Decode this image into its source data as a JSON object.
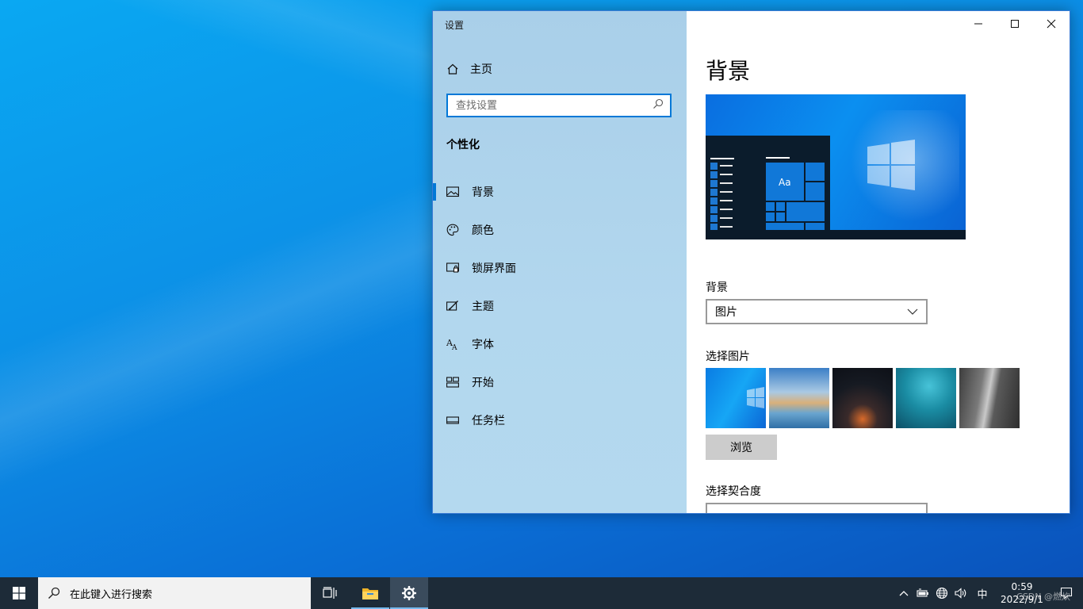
{
  "window": {
    "title": "设置",
    "controls": [
      "minimize",
      "maximize",
      "close"
    ]
  },
  "sidebar": {
    "home_label": "主页",
    "search_placeholder": "查找设置",
    "section_title": "个性化",
    "items": [
      {
        "label": "背景",
        "icon": "picture-icon",
        "active": true
      },
      {
        "label": "颜色",
        "icon": "palette-icon",
        "active": false
      },
      {
        "label": "锁屏界面",
        "icon": "lock-screen-icon",
        "active": false
      },
      {
        "label": "主题",
        "icon": "theme-icon",
        "active": false
      },
      {
        "label": "字体",
        "icon": "font-icon",
        "active": false
      },
      {
        "label": "开始",
        "icon": "start-icon",
        "active": false
      },
      {
        "label": "任务栏",
        "icon": "taskbar-icon",
        "active": false
      }
    ]
  },
  "main": {
    "heading": "背景",
    "preview": {
      "tile_text": "Aa"
    },
    "background_label": "背景",
    "background_value": "图片",
    "choose_picture_label": "选择图片",
    "browse_label": "浏览",
    "fit_label": "选择契合度"
  },
  "taskbar": {
    "search_placeholder": "在此键入进行搜索",
    "ime": "中",
    "time": "0:59",
    "date": "2022/9/1",
    "watermark": "CSDN @燃炊"
  },
  "colors": {
    "accent": "#0078d7",
    "taskbar": "#1d2b38",
    "sidebar": "#b2d7ee"
  }
}
